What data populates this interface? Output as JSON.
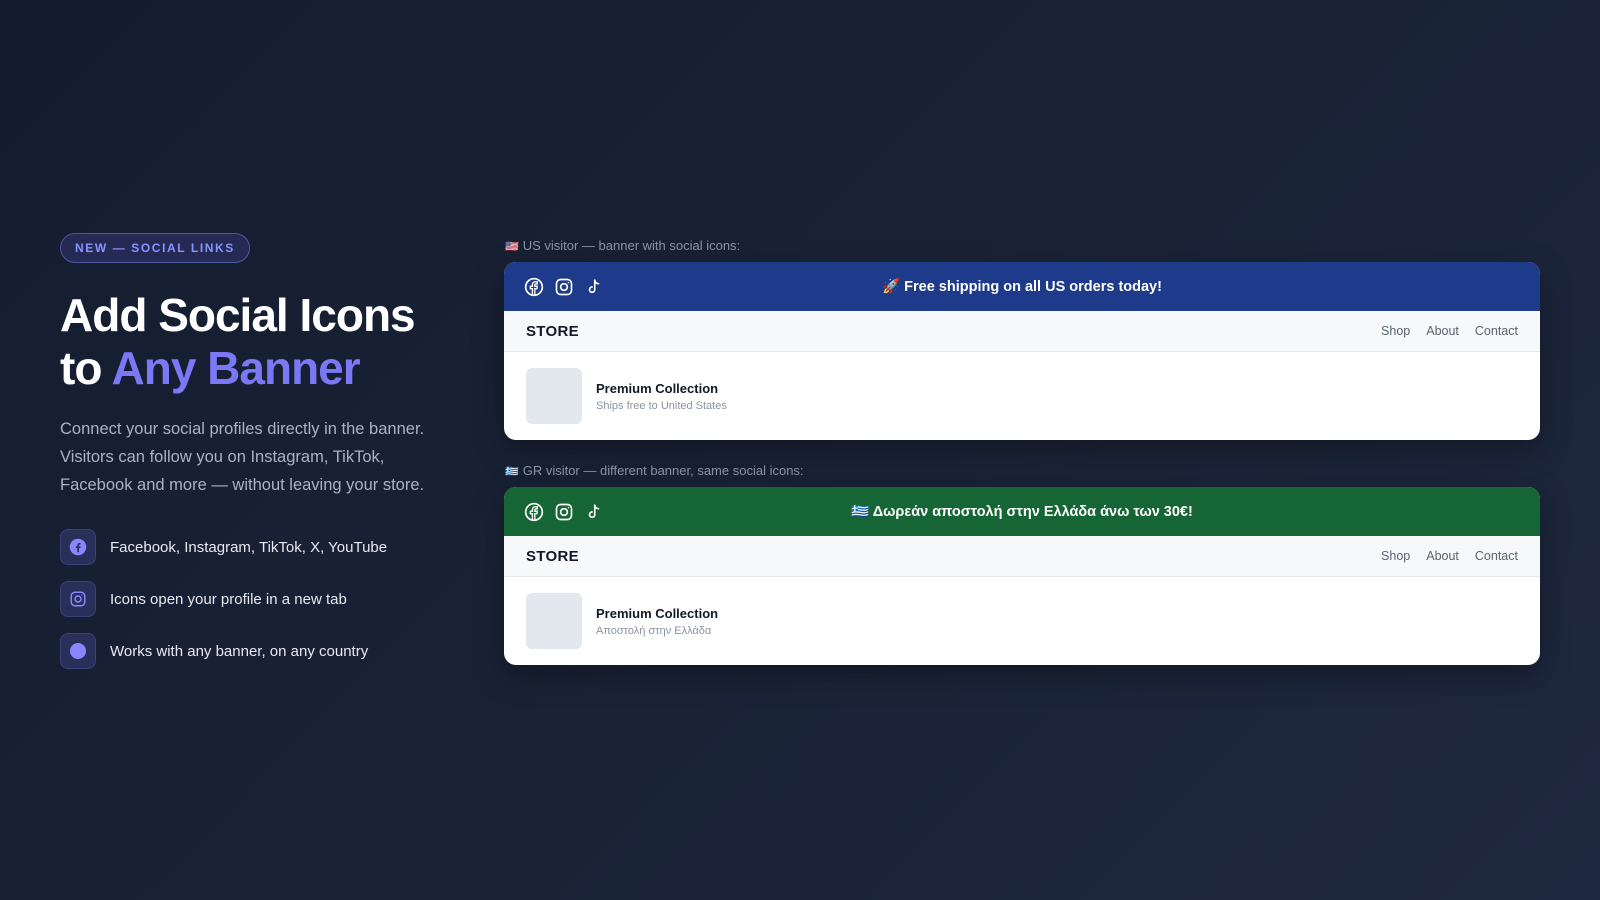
{
  "badge": "NEW — SOCIAL LINKS",
  "headline": {
    "line1": "Add Social Icons",
    "line2_prefix": "to ",
    "line2_accent": "Any Banner"
  },
  "description": "Connect your social profiles directly in the banner. Visitors can follow you on Instagram, TikTok, Facebook and more — without leaving your store.",
  "features": [
    {
      "icon": "facebook-icon",
      "text": "Facebook, Instagram, TikTok, X, YouTube"
    },
    {
      "icon": "instagram-icon",
      "text": "Icons open your profile in a new tab"
    },
    {
      "icon": "dot-icon",
      "text": "Works with any banner, on any country"
    }
  ],
  "previews": [
    {
      "flag": "🇺🇸",
      "caption": "US visitor — banner with social icons:",
      "banner_color": "#1e3a8a",
      "banner_text": "🚀 Free shipping on all US orders today!",
      "store_name": "STORE",
      "nav_links": [
        "Shop",
        "About",
        "Contact"
      ],
      "product_title": "Premium Collection",
      "product_subtitle": "Ships free to United States"
    },
    {
      "flag": "🇬🇷",
      "caption": "GR visitor — different banner, same social icons:",
      "banner_color": "#166534",
      "banner_text": "🇬🇷 Δωρεάν αποστολή στην Ελλάδα άνω των 30€!",
      "store_name": "STORE",
      "nav_links": [
        "Shop",
        "About",
        "Contact"
      ],
      "product_title": "Premium Collection",
      "product_subtitle": "Αποστολή στην Ελλάδα"
    }
  ],
  "colors": {
    "accent": "#7b78f5",
    "badge_text": "#8b93ff"
  }
}
